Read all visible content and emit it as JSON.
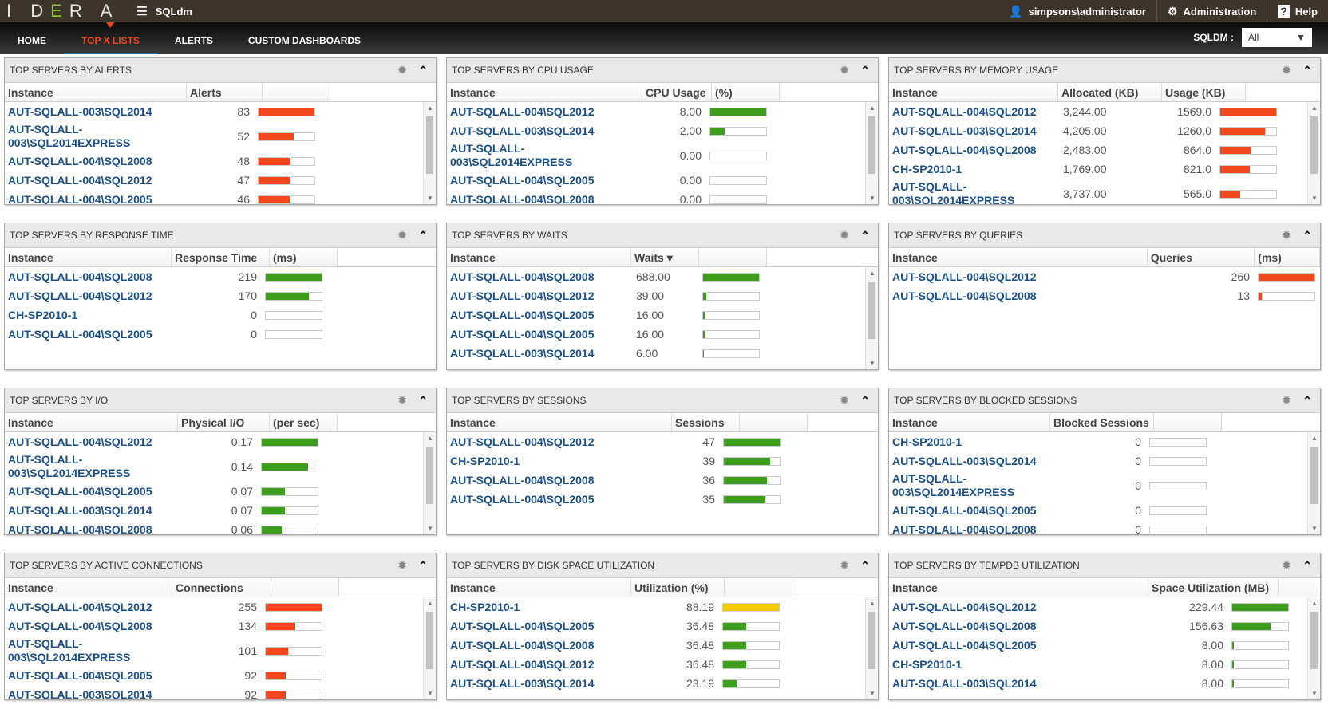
{
  "topbar": {
    "logo": "IDERA",
    "app": "SQLdm",
    "user": "simpsons\\administrator",
    "admin": "Administration",
    "help": "Help"
  },
  "nav": {
    "tabs": [
      "HOME",
      "TOP X LISTS",
      "ALERTS",
      "CUSTOM DASHBOARDS"
    ],
    "active": 1,
    "filter_label": "SQLDM :",
    "filter_value": "All"
  },
  "colors": {
    "red": "#f2461d",
    "green": "#3c9e1c",
    "yellow": "#f5c800"
  },
  "panels": [
    {
      "title": "TOP SERVERS BY ALERTS",
      "headers": [
        "Instance",
        "Alerts",
        ""
      ],
      "color": "red",
      "scroll": true,
      "rows": [
        [
          "AUT-SQLALL-003\\SQL2014",
          "83"
        ],
        [
          "AUT-SQLALL-003\\SQL2014EXPRESS",
          "52"
        ],
        [
          "AUT-SQLALL-004\\SQL2008",
          "48"
        ],
        [
          "AUT-SQLALL-004\\SQL2012",
          "47"
        ],
        [
          "AUT-SQLALL-004\\SQL2005",
          "46"
        ]
      ]
    },
    {
      "title": "TOP SERVERS BY CPU USAGE",
      "headers": [
        "Instance",
        "CPU Usage",
        "(%)"
      ],
      "color": "green",
      "scroll": true,
      "rows": [
        [
          "AUT-SQLALL-004\\SQL2012",
          "8.00"
        ],
        [
          "AUT-SQLALL-003\\SQL2014",
          "2.00"
        ],
        [
          "AUT-SQLALL-003\\SQL2014EXPRESS",
          "0.00"
        ],
        [
          "AUT-SQLALL-004\\SQL2005",
          "0.00"
        ],
        [
          "AUT-SQLALL-004\\SQL2008",
          "0.00"
        ]
      ]
    },
    {
      "title": "TOP SERVERS BY MEMORY USAGE",
      "headers": [
        "Instance",
        "Allocated (KB)",
        "Usage (KB)"
      ],
      "color": "red",
      "scroll": true,
      "rows": [
        [
          "AUT-SQLALL-004\\SQL2012",
          "3,244.00",
          "1569.0"
        ],
        [
          "AUT-SQLALL-003\\SQL2014",
          "4,205.00",
          "1260.0"
        ],
        [
          "AUT-SQLALL-004\\SQL2008",
          "2,483.00",
          "864.0"
        ],
        [
          "CH-SP2010-1",
          "1,769.00",
          "821.0"
        ],
        [
          "AUT-SQLALL-003\\SQL2014EXPRESS",
          "3,737.00",
          "565.0"
        ]
      ]
    },
    {
      "title": "TOP SERVERS BY RESPONSE TIME",
      "headers": [
        "Instance",
        "Response Time",
        "(ms)"
      ],
      "color": "green",
      "scroll": false,
      "rows": [
        [
          "AUT-SQLALL-004\\SQL2008",
          "219"
        ],
        [
          "AUT-SQLALL-004\\SQL2012",
          "170"
        ],
        [
          "CH-SP2010-1",
          "0"
        ],
        [
          "AUT-SQLALL-004\\SQL2005",
          "0"
        ]
      ]
    },
    {
      "title": "TOP SERVERS BY WAITS",
      "headers": [
        "Instance",
        "Waits ▾",
        ""
      ],
      "color": "green",
      "scroll": true,
      "rows": [
        [
          "AUT-SQLALL-004\\SQL2008",
          "688.00"
        ],
        [
          "AUT-SQLALL-004\\SQL2012",
          "39.00"
        ],
        [
          "AUT-SQLALL-004\\SQL2005",
          "16.00"
        ],
        [
          "AUT-SQLALL-004\\SQL2005",
          "16.00"
        ],
        [
          "AUT-SQLALL-003\\SQL2014",
          "6.00"
        ]
      ]
    },
    {
      "title": "TOP SERVERS BY QUERIES",
      "headers": [
        "Instance",
        "Queries",
        "(ms)"
      ],
      "color": "red",
      "scroll": false,
      "rows": [
        [
          "AUT-SQLALL-004\\SQL2012",
          "260"
        ],
        [
          "AUT-SQLALL-004\\SQL2008",
          "13"
        ]
      ]
    },
    {
      "title": "TOP SERVERS BY I/O",
      "headers": [
        "Instance",
        "Physical I/O",
        "(per sec)"
      ],
      "color": "green",
      "scroll": true,
      "rows": [
        [
          "AUT-SQLALL-004\\SQL2012",
          "0.17"
        ],
        [
          "AUT-SQLALL-003\\SQL2014EXPRESS",
          "0.14"
        ],
        [
          "AUT-SQLALL-004\\SQL2005",
          "0.07"
        ],
        [
          "AUT-SQLALL-003\\SQL2014",
          "0.07"
        ],
        [
          "AUT-SQLALL-004\\SQL2008",
          "0.06"
        ]
      ]
    },
    {
      "title": "TOP SERVERS BY SESSIONS",
      "headers": [
        "Instance",
        "Sessions",
        ""
      ],
      "color": "green",
      "scroll": false,
      "rows": [
        [
          "AUT-SQLALL-004\\SQL2012",
          "47"
        ],
        [
          "CH-SP2010-1",
          "39"
        ],
        [
          "AUT-SQLALL-004\\SQL2008",
          "36"
        ],
        [
          "AUT-SQLALL-004\\SQL2005",
          "35"
        ]
      ]
    },
    {
      "title": "TOP SERVERS BY BLOCKED SESSIONS",
      "headers": [
        "Instance",
        "Blocked Sessions",
        ""
      ],
      "color": "green",
      "scroll": true,
      "rows": [
        [
          "CH-SP2010-1",
          "0"
        ],
        [
          "AUT-SQLALL-003\\SQL2014",
          "0"
        ],
        [
          "AUT-SQLALL-003\\SQL2014EXPRESS",
          "0"
        ],
        [
          "AUT-SQLALL-004\\SQL2005",
          "0"
        ],
        [
          "AUT-SQLALL-004\\SQL2008",
          "0"
        ]
      ]
    },
    {
      "title": "TOP SERVERS BY ACTIVE CONNECTIONS",
      "headers": [
        "Instance",
        "Connections",
        ""
      ],
      "color": "red",
      "scroll": true,
      "rows": [
        [
          "AUT-SQLALL-004\\SQL2012",
          "255"
        ],
        [
          "AUT-SQLALL-004\\SQL2008",
          "134"
        ],
        [
          "AUT-SQLALL-003\\SQL2014EXPRESS",
          "101"
        ],
        [
          "AUT-SQLALL-004\\SQL2005",
          "92"
        ],
        [
          "AUT-SQLALL-003\\SQL2014",
          "92"
        ]
      ]
    },
    {
      "title": "TOP SERVERS BY DISK SPACE UTILIZATION",
      "headers": [
        "Instance",
        "Utilization (%)",
        ""
      ],
      "color": "green",
      "scroll": true,
      "rows": [
        [
          "CH-SP2010-1",
          "88.19",
          "yellow"
        ],
        [
          "AUT-SQLALL-004\\SQL2005",
          "36.48"
        ],
        [
          "AUT-SQLALL-004\\SQL2008",
          "36.48"
        ],
        [
          "AUT-SQLALL-004\\SQL2012",
          "36.48"
        ],
        [
          "AUT-SQLALL-003\\SQL2014",
          "23.19"
        ]
      ]
    },
    {
      "title": "TOP SERVERS BY TEMPDB UTILIZATION",
      "headers": [
        "Instance",
        "Space Utilization (MB)",
        ""
      ],
      "color": "green",
      "scroll": true,
      "rows": [
        [
          "AUT-SQLALL-004\\SQL2012",
          "229.44"
        ],
        [
          "AUT-SQLALL-004\\SQL2008",
          "156.63"
        ],
        [
          "AUT-SQLALL-004\\SQL2005",
          "8.00"
        ],
        [
          "CH-SP2010-1",
          "8.00"
        ],
        [
          "AUT-SQLALL-003\\SQL2014",
          "8.00"
        ]
      ]
    }
  ]
}
